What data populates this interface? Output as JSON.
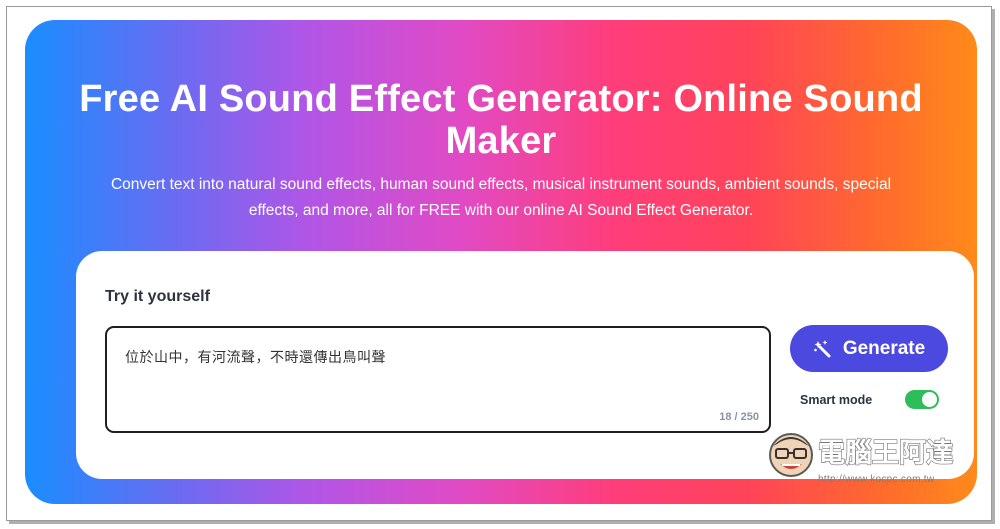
{
  "hero": {
    "title": "Free AI Sound Effect Generator: Online Sound Maker",
    "subtitle": "Convert text into natural sound effects, human sound effects, musical instrument sounds, ambient sounds, special effects, and more, all for FREE with our online AI Sound Effect Generator."
  },
  "tool": {
    "try_label": "Try it yourself",
    "input_value": "位於山中，有河流聲，不時還傳出鳥叫聲",
    "char_count": "18 / 250",
    "generate_label": "Generate",
    "smart_mode_label": "Smart mode",
    "smart_mode_on": true
  },
  "watermark": {
    "brand": "電腦王阿達",
    "url": "http://www.kocpc.com.tw"
  },
  "colors": {
    "button": "#4b49e0",
    "toggle": "#2ebd59",
    "gradient_start": "#1a8dff",
    "gradient_end": "#ff8a1a"
  },
  "icons": {
    "generate": "sparkle-wand-icon",
    "watermark": "mascot-face-icon"
  }
}
